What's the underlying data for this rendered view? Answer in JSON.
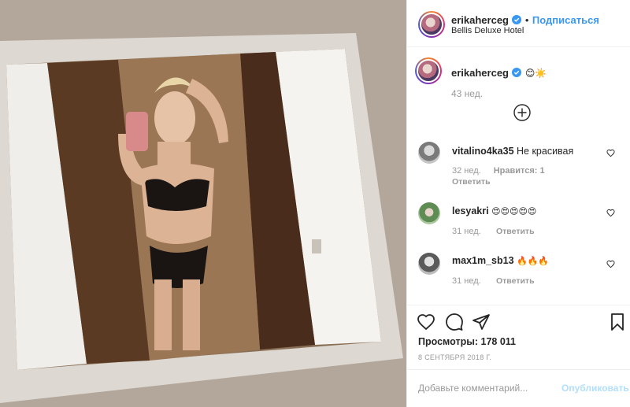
{
  "post": {
    "username": "erikaherceg",
    "follow_label": "Подписаться",
    "location": "Bellis Deluxe Hotel",
    "caption_text": "😊☀️",
    "caption_age": "43 нед."
  },
  "comments": [
    {
      "user": "vitalino4ka35",
      "text": "Не красивая",
      "age": "32 нед.",
      "likes": "Нравится: 1",
      "reply": "Ответить"
    },
    {
      "user": "lesyakri",
      "text": "😍😍😍😍😍",
      "age": "31 нед.",
      "reply": "Ответить"
    },
    {
      "user": "max1m_sb13",
      "text": "🔥🔥🔥",
      "age": "31 нед.",
      "reply": "Ответить"
    }
  ],
  "actions": {
    "views": "Просмотры: 178 011",
    "date": "8 СЕНТЯБРЯ 2018 Г.",
    "comment_placeholder": "Добавьте комментарий...",
    "publish_label": "Опубликовать"
  },
  "icons": {
    "like": "heart-icon",
    "comment": "comment-icon",
    "share": "share-icon",
    "save": "bookmark-icon",
    "expand": "plus-circle-icon",
    "verified": "verified-badge-icon"
  },
  "colors": {
    "accent": "#3897f0",
    "muted": "#999999",
    "publish_disabled": "#b2dffc"
  }
}
